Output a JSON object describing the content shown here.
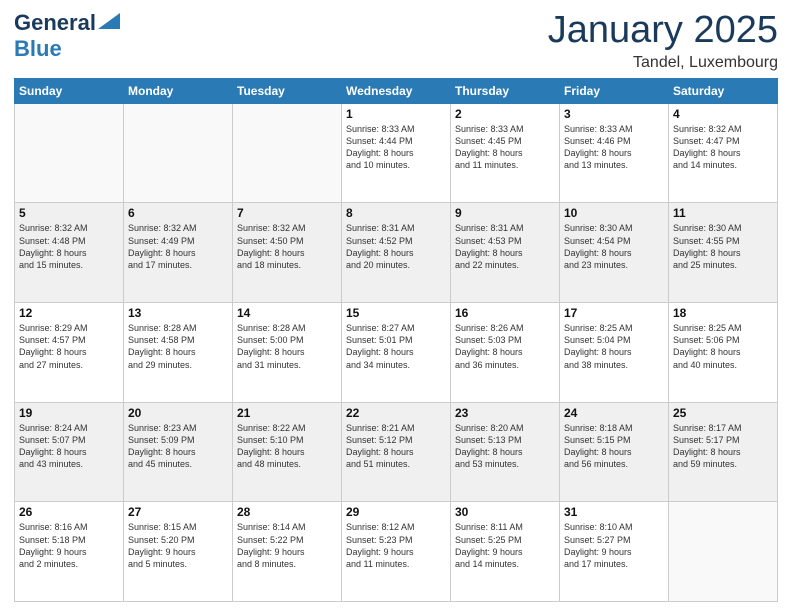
{
  "logo": {
    "line1": "General",
    "line2": "Blue"
  },
  "header": {
    "month": "January 2025",
    "location": "Tandel, Luxembourg"
  },
  "weekdays": [
    "Sunday",
    "Monday",
    "Tuesday",
    "Wednesday",
    "Thursday",
    "Friday",
    "Saturday"
  ],
  "weeks": [
    [
      {
        "day": "",
        "info": ""
      },
      {
        "day": "",
        "info": ""
      },
      {
        "day": "",
        "info": ""
      },
      {
        "day": "1",
        "info": "Sunrise: 8:33 AM\nSunset: 4:44 PM\nDaylight: 8 hours\nand 10 minutes."
      },
      {
        "day": "2",
        "info": "Sunrise: 8:33 AM\nSunset: 4:45 PM\nDaylight: 8 hours\nand 11 minutes."
      },
      {
        "day": "3",
        "info": "Sunrise: 8:33 AM\nSunset: 4:46 PM\nDaylight: 8 hours\nand 13 minutes."
      },
      {
        "day": "4",
        "info": "Sunrise: 8:32 AM\nSunset: 4:47 PM\nDaylight: 8 hours\nand 14 minutes."
      }
    ],
    [
      {
        "day": "5",
        "info": "Sunrise: 8:32 AM\nSunset: 4:48 PM\nDaylight: 8 hours\nand 15 minutes."
      },
      {
        "day": "6",
        "info": "Sunrise: 8:32 AM\nSunset: 4:49 PM\nDaylight: 8 hours\nand 17 minutes."
      },
      {
        "day": "7",
        "info": "Sunrise: 8:32 AM\nSunset: 4:50 PM\nDaylight: 8 hours\nand 18 minutes."
      },
      {
        "day": "8",
        "info": "Sunrise: 8:31 AM\nSunset: 4:52 PM\nDaylight: 8 hours\nand 20 minutes."
      },
      {
        "day": "9",
        "info": "Sunrise: 8:31 AM\nSunset: 4:53 PM\nDaylight: 8 hours\nand 22 minutes."
      },
      {
        "day": "10",
        "info": "Sunrise: 8:30 AM\nSunset: 4:54 PM\nDaylight: 8 hours\nand 23 minutes."
      },
      {
        "day": "11",
        "info": "Sunrise: 8:30 AM\nSunset: 4:55 PM\nDaylight: 8 hours\nand 25 minutes."
      }
    ],
    [
      {
        "day": "12",
        "info": "Sunrise: 8:29 AM\nSunset: 4:57 PM\nDaylight: 8 hours\nand 27 minutes."
      },
      {
        "day": "13",
        "info": "Sunrise: 8:28 AM\nSunset: 4:58 PM\nDaylight: 8 hours\nand 29 minutes."
      },
      {
        "day": "14",
        "info": "Sunrise: 8:28 AM\nSunset: 5:00 PM\nDaylight: 8 hours\nand 31 minutes."
      },
      {
        "day": "15",
        "info": "Sunrise: 8:27 AM\nSunset: 5:01 PM\nDaylight: 8 hours\nand 34 minutes."
      },
      {
        "day": "16",
        "info": "Sunrise: 8:26 AM\nSunset: 5:03 PM\nDaylight: 8 hours\nand 36 minutes."
      },
      {
        "day": "17",
        "info": "Sunrise: 8:25 AM\nSunset: 5:04 PM\nDaylight: 8 hours\nand 38 minutes."
      },
      {
        "day": "18",
        "info": "Sunrise: 8:25 AM\nSunset: 5:06 PM\nDaylight: 8 hours\nand 40 minutes."
      }
    ],
    [
      {
        "day": "19",
        "info": "Sunrise: 8:24 AM\nSunset: 5:07 PM\nDaylight: 8 hours\nand 43 minutes."
      },
      {
        "day": "20",
        "info": "Sunrise: 8:23 AM\nSunset: 5:09 PM\nDaylight: 8 hours\nand 45 minutes."
      },
      {
        "day": "21",
        "info": "Sunrise: 8:22 AM\nSunset: 5:10 PM\nDaylight: 8 hours\nand 48 minutes."
      },
      {
        "day": "22",
        "info": "Sunrise: 8:21 AM\nSunset: 5:12 PM\nDaylight: 8 hours\nand 51 minutes."
      },
      {
        "day": "23",
        "info": "Sunrise: 8:20 AM\nSunset: 5:13 PM\nDaylight: 8 hours\nand 53 minutes."
      },
      {
        "day": "24",
        "info": "Sunrise: 8:18 AM\nSunset: 5:15 PM\nDaylight: 8 hours\nand 56 minutes."
      },
      {
        "day": "25",
        "info": "Sunrise: 8:17 AM\nSunset: 5:17 PM\nDaylight: 8 hours\nand 59 minutes."
      }
    ],
    [
      {
        "day": "26",
        "info": "Sunrise: 8:16 AM\nSunset: 5:18 PM\nDaylight: 9 hours\nand 2 minutes."
      },
      {
        "day": "27",
        "info": "Sunrise: 8:15 AM\nSunset: 5:20 PM\nDaylight: 9 hours\nand 5 minutes."
      },
      {
        "day": "28",
        "info": "Sunrise: 8:14 AM\nSunset: 5:22 PM\nDaylight: 9 hours\nand 8 minutes."
      },
      {
        "day": "29",
        "info": "Sunrise: 8:12 AM\nSunset: 5:23 PM\nDaylight: 9 hours\nand 11 minutes."
      },
      {
        "day": "30",
        "info": "Sunrise: 8:11 AM\nSunset: 5:25 PM\nDaylight: 9 hours\nand 14 minutes."
      },
      {
        "day": "31",
        "info": "Sunrise: 8:10 AM\nSunset: 5:27 PM\nDaylight: 9 hours\nand 17 minutes."
      },
      {
        "day": "",
        "info": ""
      }
    ]
  ]
}
